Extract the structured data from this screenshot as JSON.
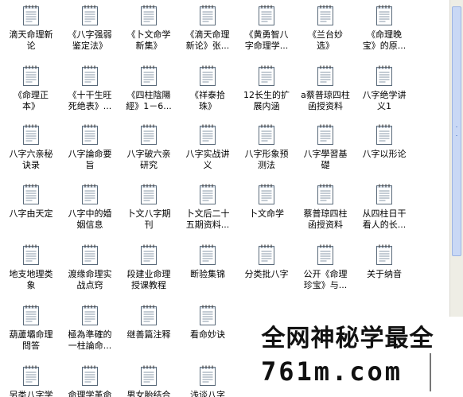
{
  "files": [
    {
      "name": "滴天命理新\n论"
    },
    {
      "name": "《八字强弱\n鉴定法》"
    },
    {
      "name": "《卜文命学\n新集》"
    },
    {
      "name": "《滴天命理\n新论》张..."
    },
    {
      "name": "《黄勇智八\n字命理学..."
    },
    {
      "name": "《兰台妙\n选》"
    },
    {
      "name": "《命理晚\n宝》的原..."
    },
    {
      "name": "《命理正\n本》"
    },
    {
      "name": "《十干生旺\n死绝表》..."
    },
    {
      "name": "《四柱陰陽\n經》1－6..."
    },
    {
      "name": "《祥泰拾\n珠》"
    },
    {
      "name": "12长生的扩\n展内涵"
    },
    {
      "name": "a蔡普琼四柱\n函授资料"
    },
    {
      "name": "八字绝学讲\n义1"
    },
    {
      "name": "八字六亲秘\n诀录"
    },
    {
      "name": "八字論命要\n旨"
    },
    {
      "name": "八字破六亲\n研究"
    },
    {
      "name": "八字实战讲\n义"
    },
    {
      "name": "八字形象预\n测法"
    },
    {
      "name": "八字學習基\n礎"
    },
    {
      "name": "八字以形论"
    },
    {
      "name": "八字由天定"
    },
    {
      "name": "八字中的婚\n姻信息"
    },
    {
      "name": "卜文八字期\n刊"
    },
    {
      "name": "卜文后二十\n五期资料..."
    },
    {
      "name": "卜文命学"
    },
    {
      "name": "蔡普琼四柱\n函授资料"
    },
    {
      "name": "从四柱日干\n看人的长..."
    },
    {
      "name": "地支地理类\n象"
    },
    {
      "name": "渡缘命理实\n战点窍"
    },
    {
      "name": "段建业命理\n授课教程"
    },
    {
      "name": "断验集锦"
    },
    {
      "name": "分类批八字"
    },
    {
      "name": "公开《命理\n珍宝》与..."
    },
    {
      "name": "关于纳音"
    },
    {
      "name": "葫蘆壩命理\n問答"
    },
    {
      "name": "極為準確的\n一柱論命..."
    },
    {
      "name": "继善篇注释"
    },
    {
      "name": "看命妙诀"
    },
    {
      "name": ""
    },
    {
      "name": ""
    },
    {
      "name": ""
    },
    {
      "name": "另类八字学"
    },
    {
      "name": "命理学革命"
    },
    {
      "name": "男女胎结合"
    },
    {
      "name": "浅谈八字"
    }
  ],
  "icon": "text-document-icon",
  "watermark": {
    "line1": "全网神秘学最全",
    "line2": "761m.com"
  },
  "colors": {
    "background": "#ffffff",
    "scroll_thumb": "#c9d8f5"
  }
}
